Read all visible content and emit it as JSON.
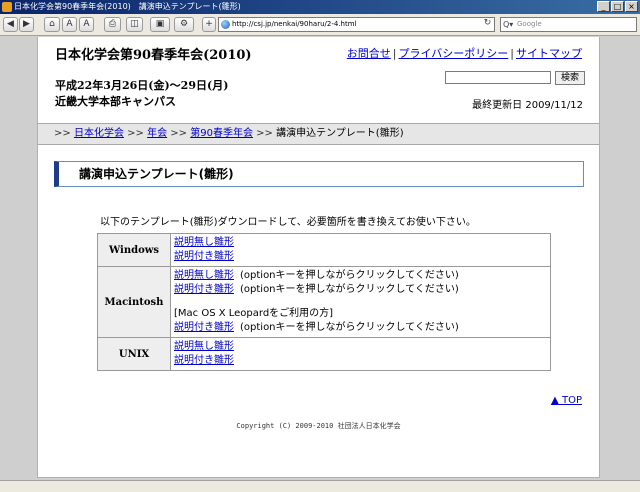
{
  "window": {
    "title": "日本化学会第90春季年会(2010)　講演申込テンプレート(雛形)",
    "controls": {
      "minimize": "_",
      "maximize": "□",
      "close": "×"
    }
  },
  "browser": {
    "nav_buttons": [
      "◀",
      "▶",
      "⌂",
      "A",
      "A",
      "⎙",
      "◫",
      "▣",
      "⚙",
      "+"
    ],
    "url": "http://csj.jp/nenkai/90haru/2-4.html",
    "reload_icon": "↻",
    "search_label": "Q▾",
    "search_placeholder": "Google"
  },
  "header": {
    "site_title": "日本化学会第90春季年会(2010)",
    "links": [
      "お問合せ",
      "プライバシーポリシー",
      "サイトマップ"
    ],
    "link_separator": "|",
    "date_line": "平成22年3月26日(金)〜29日(月)",
    "venue_line": "近畿大学本部キャンパス",
    "search_button": "検索",
    "last_updated": "最終更新日 2009/11/12"
  },
  "breadcrumb": {
    "sep": ">>",
    "items": [
      "日本化学会",
      "年会",
      "第90春季年会"
    ],
    "current": "講演申込テンプレート(雛形)"
  },
  "main": {
    "heading": "講演申込テンプレート(雛形)",
    "intro": "以下のテンプレート(雛形)ダウンロードして、必要箇所を書き換えてお使い下さい。",
    "rows": [
      {
        "os": "Windows",
        "link1": "説明無し雛形",
        "link2": "説明付き雛形"
      },
      {
        "os": "Macintosh",
        "link1": "説明無し雛形",
        "note1": "(optionキーを押しながらクリックしてください)",
        "link2": "説明付き雛形",
        "note2": "(optionキーを押しながらクリックしてください)",
        "leopard_label": "[Mac OS X Leopardをご利用の方]",
        "link3": "説明付き雛形",
        "note3": "(optionキーを押しながらクリックしてください)"
      },
      {
        "os": "UNIX",
        "link1": "説明無し雛形",
        "link2": "説明付き雛形"
      }
    ]
  },
  "footer": {
    "top_arrow": "▲",
    "top_label": "TOP",
    "copyright": "Copyright (C) 2009-2010 社団法人日本化学会"
  }
}
